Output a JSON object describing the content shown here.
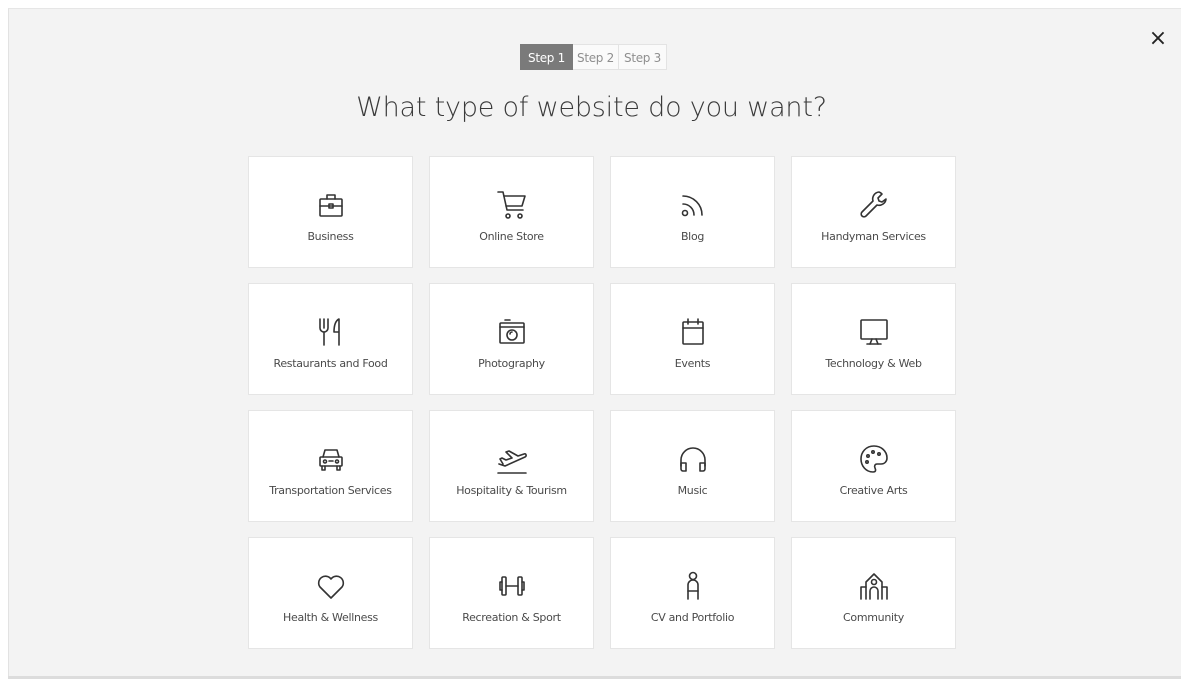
{
  "close_label": "×",
  "steps": [
    {
      "label": "Step 1",
      "active": true
    },
    {
      "label": "Step 2",
      "active": false
    },
    {
      "label": "Step 3",
      "active": false
    }
  ],
  "headline": "What type of website do you want?",
  "categories": [
    {
      "label": "Business",
      "icon": "briefcase-icon"
    },
    {
      "label": "Online Store",
      "icon": "cart-icon"
    },
    {
      "label": "Blog",
      "icon": "rss-icon"
    },
    {
      "label": "Handyman Services",
      "icon": "wrench-icon"
    },
    {
      "label": "Restaurants and Food",
      "icon": "utensils-icon"
    },
    {
      "label": "Photography",
      "icon": "camera-icon"
    },
    {
      "label": "Events",
      "icon": "calendar-icon"
    },
    {
      "label": "Technology & Web",
      "icon": "monitor-icon"
    },
    {
      "label": "Transportation Services",
      "icon": "car-icon"
    },
    {
      "label": "Hospitality & Tourism",
      "icon": "plane-icon"
    },
    {
      "label": "Music",
      "icon": "headphones-icon"
    },
    {
      "label": "Creative Arts",
      "icon": "palette-icon"
    },
    {
      "label": "Health & Wellness",
      "icon": "heart-icon"
    },
    {
      "label": "Recreation & Sport",
      "icon": "dumbbell-icon"
    },
    {
      "label": "CV and Portfolio",
      "icon": "person-icon"
    },
    {
      "label": "Community",
      "icon": "building-icon"
    }
  ]
}
